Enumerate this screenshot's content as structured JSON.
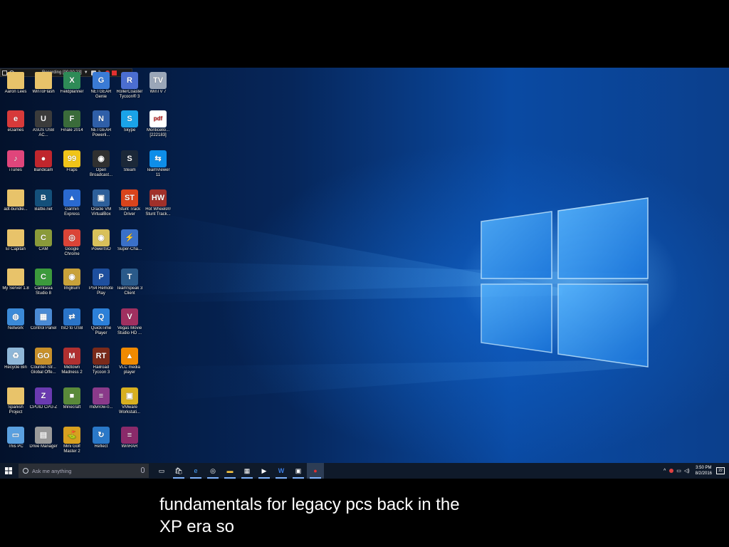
{
  "recorder": {
    "status_text": "Recording [00:00:23]"
  },
  "desktop_icons": [
    {
      "label": "Aaron Lees",
      "icon": "folder-icon",
      "color": "#e8c36a",
      "glyph": ""
    },
    {
      "label": "WinToFlash",
      "icon": "folder-icon",
      "color": "#e8c36a",
      "glyph": ""
    },
    {
      "label": "Fieldplanner",
      "icon": "spreadsheet-icon",
      "color": "#2e8b57",
      "glyph": "X"
    },
    {
      "label": "NETGEAR Genie",
      "icon": "netgear-genie-icon",
      "color": "#3a7bd5",
      "glyph": "G"
    },
    {
      "label": "RollerCoaster Tycoon® 3",
      "icon": "rollercoaster-icon",
      "color": "#4b6ed0",
      "glyph": "R"
    },
    {
      "label": "WinTV 7",
      "icon": "wintv-icon",
      "color": "#9aa6b8",
      "glyph": "TV"
    },
    {
      "label": "eGames",
      "icon": "egames-icon",
      "color": "#d73a3a",
      "glyph": "e"
    },
    {
      "label": "ASUS USB AC...",
      "icon": "asus-usb-icon",
      "color": "#3b3b3b",
      "glyph": "U"
    },
    {
      "label": "Finale 2014",
      "icon": "finale-icon",
      "color": "#3a6b3a",
      "glyph": "F"
    },
    {
      "label": "NETGEAR Powerli...",
      "icon": "netgear-powerline-icon",
      "color": "#2f5fa8",
      "glyph": "N"
    },
    {
      "label": "Skype",
      "icon": "skype-icon",
      "color": "#1aa3e8",
      "glyph": "S"
    },
    {
      "label": "Monticello... [222183]",
      "icon": "pdf-file-icon",
      "color": "#ffffff",
      "glyph": "pdf"
    },
    {
      "label": "iTunes",
      "icon": "itunes-icon",
      "color": "#e0457b",
      "glyph": "♪"
    },
    {
      "label": "Bandicam",
      "icon": "bandicam-icon",
      "color": "#c0262d",
      "glyph": "●"
    },
    {
      "label": "Fraps",
      "icon": "fraps-icon",
      "color": "#f0c419",
      "glyph": "99"
    },
    {
      "label": "Open Broadcast...",
      "icon": "obs-icon",
      "color": "#303030",
      "glyph": "◉"
    },
    {
      "label": "Steam",
      "icon": "steam-icon",
      "color": "#1b2838",
      "glyph": "S"
    },
    {
      "label": "TeamViewer 11",
      "icon": "teamviewer-icon",
      "color": "#0e8ee9",
      "glyph": "⇆"
    },
    {
      "label": "adt-bundle...",
      "icon": "folder-icon",
      "color": "#e8c36a",
      "glyph": ""
    },
    {
      "label": "Battle.net",
      "icon": "battlenet-icon",
      "color": "#14507a",
      "glyph": "B"
    },
    {
      "label": "Garmin Express",
      "icon": "garmin-icon",
      "color": "#2a6ad0",
      "glyph": "▲"
    },
    {
      "label": "Oracle VM VirtualBox",
      "icon": "virtualbox-icon",
      "color": "#2d5f9a",
      "glyph": "▣"
    },
    {
      "label": "Stunt Track Driver",
      "icon": "stunt-track-icon",
      "color": "#d9441c",
      "glyph": "ST"
    },
    {
      "label": "Hot Wheels® Stunt Track...",
      "icon": "hot-wheels-icon",
      "color": "#a0302a",
      "glyph": "HW"
    },
    {
      "label": "El Capitan",
      "icon": "folder-icon",
      "color": "#e8c36a",
      "glyph": ""
    },
    {
      "label": "CAM",
      "icon": "cam-icon",
      "color": "#8a9a3a",
      "glyph": "C"
    },
    {
      "label": "Google Chrome",
      "icon": "chrome-icon",
      "color": "#db4437",
      "glyph": "◎"
    },
    {
      "label": "PowerISO",
      "icon": "poweriso-icon",
      "color": "#d8c05a",
      "glyph": "◉"
    },
    {
      "label": "Super-Cha...",
      "icon": "super-cha-icon",
      "color": "#3a70c8",
      "glyph": "⚡"
    },
    {
      "label": "",
      "icon": "",
      "color": "",
      "glyph": ""
    },
    {
      "label": "My Server 1.8",
      "icon": "folder-icon",
      "color": "#e8c36a",
      "glyph": ""
    },
    {
      "label": "Camtasia Studio 8",
      "icon": "camtasia-icon",
      "color": "#3c9a3c",
      "glyph": "C"
    },
    {
      "label": "ImgBurn",
      "icon": "imgburn-icon",
      "color": "#c9a23a",
      "glyph": "◉"
    },
    {
      "label": "PS4 Remote Play",
      "icon": "ps4-remote-icon",
      "color": "#1e4f9e",
      "glyph": "P"
    },
    {
      "label": "TeamSpeak 3 Client",
      "icon": "teamspeak-icon",
      "color": "#2a5a8a",
      "glyph": "T"
    },
    {
      "label": "",
      "icon": "",
      "color": "",
      "glyph": ""
    },
    {
      "label": "Network",
      "icon": "network-icon",
      "color": "#3b8ad8",
      "glyph": "◍"
    },
    {
      "label": "Control Panel",
      "icon": "control-panel-icon",
      "color": "#4a8ad4",
      "glyph": "▦"
    },
    {
      "label": "ISO to USB",
      "icon": "iso-to-usb-icon",
      "color": "#2a74c8",
      "glyph": "⇄"
    },
    {
      "label": "QuickTime Player",
      "icon": "quicktime-icon",
      "color": "#2c80d8",
      "glyph": "Q"
    },
    {
      "label": "Vegas Movie Studio HD ...",
      "icon": "vegas-icon",
      "color": "#a03060",
      "glyph": "V"
    },
    {
      "label": "",
      "icon": "",
      "color": "",
      "glyph": ""
    },
    {
      "label": "Recycle Bin",
      "icon": "recycle-bin-icon",
      "color": "#8fb7d8",
      "glyph": "♻"
    },
    {
      "label": "Counter-Str... Global Offe...",
      "icon": "csgo-icon",
      "color": "#c8902a",
      "glyph": "GO"
    },
    {
      "label": "Midtown Madness 2",
      "icon": "midtown-madness-icon",
      "color": "#b03030",
      "glyph": "M"
    },
    {
      "label": "Railroad Tycoon 3",
      "icon": "railroad-tycoon-icon",
      "color": "#7a2a1a",
      "glyph": "RT"
    },
    {
      "label": "VLC media player",
      "icon": "vlc-icon",
      "color": "#f08a00",
      "glyph": "▲"
    },
    {
      "label": "",
      "icon": "",
      "color": "",
      "glyph": ""
    },
    {
      "label": "Spanish Project",
      "icon": "folder-icon",
      "color": "#e8c36a",
      "glyph": ""
    },
    {
      "label": "CPUID CPU-Z",
      "icon": "cpuz-icon",
      "color": "#6a3ab0",
      "glyph": "Z"
    },
    {
      "label": "Minecraft",
      "icon": "minecraft-icon",
      "color": "#5a8a3a",
      "glyph": "■"
    },
    {
      "label": "rndvn0w-0...",
      "icon": "archive-icon",
      "color": "#8a3a8a",
      "glyph": "≡"
    },
    {
      "label": "VMware Workstati...",
      "icon": "vmware-icon",
      "color": "#d8b020",
      "glyph": "▣"
    },
    {
      "label": "",
      "icon": "",
      "color": "",
      "glyph": ""
    },
    {
      "label": "This PC",
      "icon": "this-pc-icon",
      "color": "#5aa0e0",
      "glyph": "▭"
    },
    {
      "label": "Drive Manager",
      "icon": "drive-manager-icon",
      "color": "#9a9a9a",
      "glyph": "▤"
    },
    {
      "label": "Mini Golf Master 2",
      "icon": "mini-golf-icon",
      "color": "#d8a020",
      "glyph": "⛳"
    },
    {
      "label": "Reflect",
      "icon": "reflect-icon",
      "color": "#2a78c8",
      "glyph": "↻"
    },
    {
      "label": "WinRAR",
      "icon": "winrar-icon",
      "color": "#8a2a6a",
      "glyph": "≡"
    }
  ],
  "taskbar": {
    "search_placeholder": "Ask me anything",
    "apps": [
      {
        "name": "task-view-icon",
        "glyph": "▭"
      },
      {
        "name": "store-bag-icon",
        "glyph": "🛍"
      },
      {
        "name": "edge-icon",
        "glyph": "e"
      },
      {
        "name": "chrome-icon",
        "glyph": "◎"
      },
      {
        "name": "file-explorer-icon",
        "glyph": "▬"
      },
      {
        "name": "store-icon",
        "glyph": "▦"
      },
      {
        "name": "media-player-icon",
        "glyph": "▶"
      },
      {
        "name": "word-icon",
        "glyph": "W"
      },
      {
        "name": "virtualbox-icon",
        "glyph": "▣"
      },
      {
        "name": "bandicam-icon",
        "glyph": "●"
      }
    ],
    "clock_time": "3:50 PM",
    "clock_date": "8/2/2016",
    "notification_count": "22"
  },
  "caption": {
    "line1": "fundamentals for legacy pcs back in the",
    "line2": "XP era so"
  }
}
